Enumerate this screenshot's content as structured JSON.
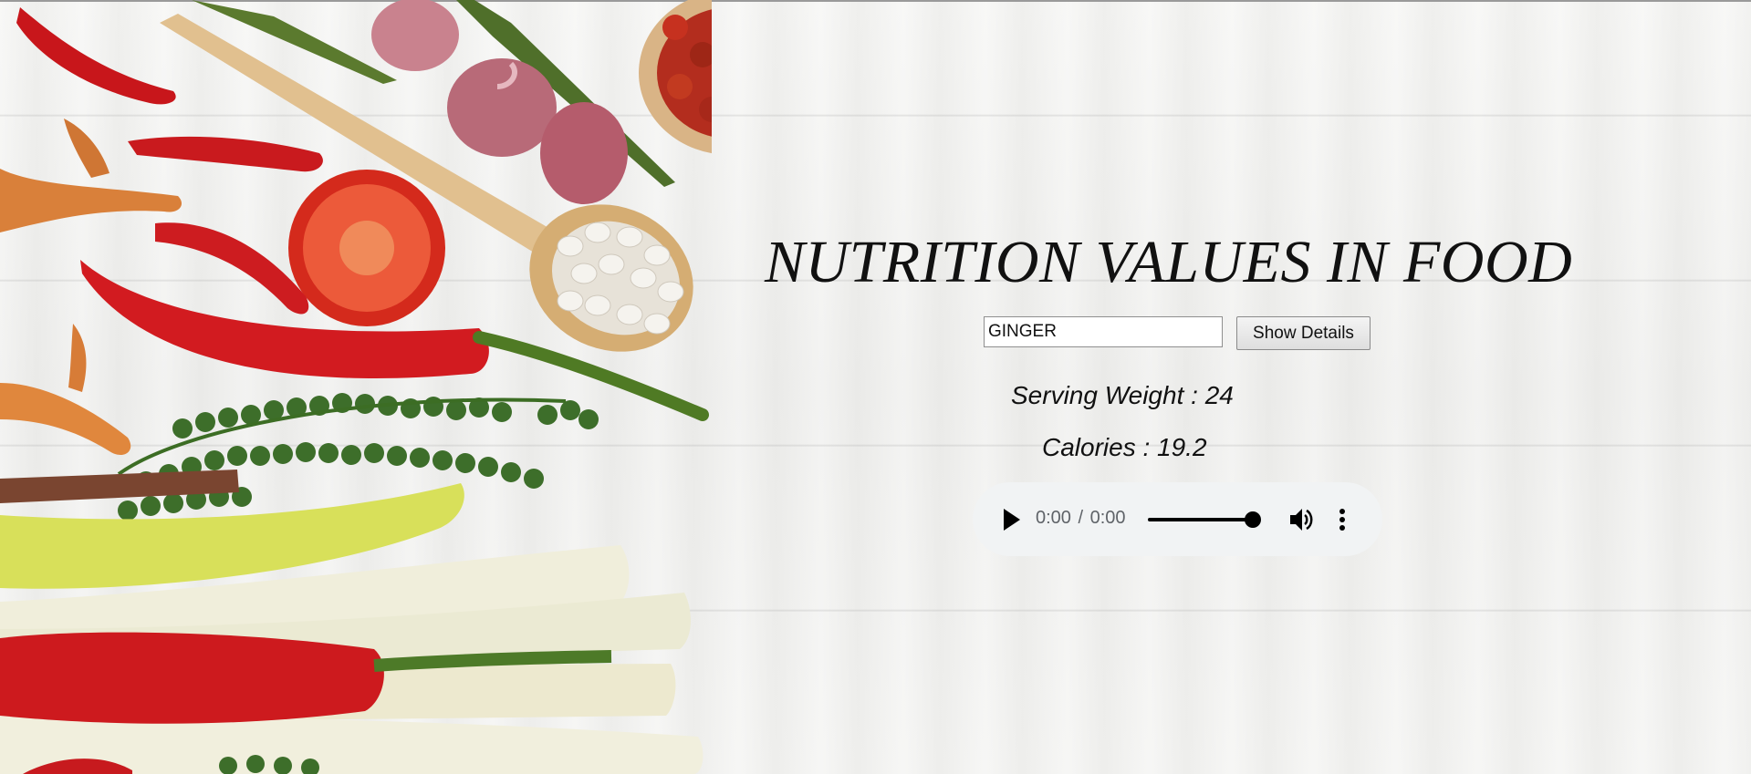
{
  "page": {
    "title": "NUTRITION VALUES IN FOOD"
  },
  "search": {
    "value": "GINGER",
    "button_label": "Show Details"
  },
  "nutrition": {
    "serving_weight": "Serving Weight : 24",
    "calories": "Calories : 19.2"
  },
  "audio_player": {
    "current_time": "0:00",
    "separator": "/",
    "duration": "0:00",
    "progress_fraction": 1.0,
    "play_icon": "play-icon",
    "volume_icon": "volume-icon",
    "more_icon": "more-options-icon"
  },
  "colors": {
    "player_background": "#f1f3f4",
    "player_text": "#5f6368",
    "title_text": "#111111"
  }
}
